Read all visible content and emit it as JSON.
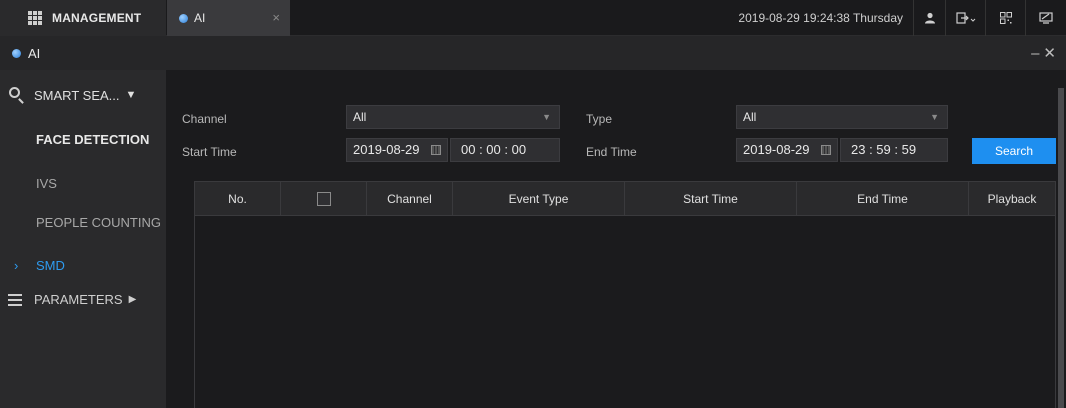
{
  "topbar": {
    "management_label": "MANAGEMENT",
    "tab_label": "AI",
    "tab_close": "×",
    "datetime": "2019-08-29 19:24:38 Thursday"
  },
  "titlebar": {
    "title": "AI",
    "controls": "–✕"
  },
  "sidebar": {
    "section_label": "SMART SEA...",
    "items": [
      {
        "label": "FACE DETECTION"
      },
      {
        "label": "IVS"
      },
      {
        "label": "PEOPLE COUNTING"
      },
      {
        "label": "SMD"
      }
    ],
    "parameters_label": "PARAMETERS"
  },
  "filters": {
    "channel_label": "Channel",
    "channel_value": "All",
    "type_label": "Type",
    "type_value": "All",
    "start_time_label": "Start Time",
    "start_date": "2019-08-29",
    "start_time": "00 : 00 : 00",
    "end_time_label": "End Time",
    "end_date": "2019-08-29",
    "end_time": "23 : 59 : 59",
    "search_label": "Search"
  },
  "table": {
    "columns": [
      "No.",
      "",
      "Channel",
      "Event Type",
      "Start Time",
      "End Time",
      "Playback"
    ]
  },
  "colors": {
    "accent": "#1e8ff0",
    "active_item": "#2e9bf0"
  }
}
